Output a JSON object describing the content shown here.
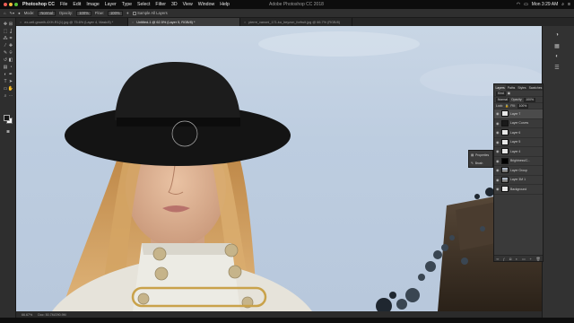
{
  "menubar": {
    "app_name": "Photoshop CC",
    "items": [
      "File",
      "Edit",
      "Image",
      "Layer",
      "Type",
      "Select",
      "Filter",
      "3D",
      "View",
      "Window",
      "Help"
    ],
    "window_title": "Adobe Photoshop CC 2018",
    "clock": "Mon 3:29 AM"
  },
  "options_bar": {
    "mode_label": "Mode:",
    "mode_value": "Normal",
    "opacity_label": "Opacity:",
    "opacity_value": "100%",
    "flow_label": "Flow:",
    "flow_value": "100%",
    "sample_label": "Sample All Layers"
  },
  "tabs": [
    {
      "label": "ex-cell-growth-4XH-R1(1).jpg @ 75.6% (Layer 4, Mask/8) *",
      "active": false
    },
    {
      "label": "Untitled-1 @ 62.5% (Layer 5, RGB/8) *",
      "active": true
    },
    {
      "label": "pierre_vanoni_171-ko_heyzon_forfruit.jpg @ 66.7% (RGB/8)",
      "active": false
    }
  ],
  "status": {
    "zoom": "66.67%",
    "doc_info": "Doc: 50.7M/290.9M"
  },
  "layers_panel": {
    "tabs": [
      "Layers",
      "Paths",
      "Styles",
      "Swatches"
    ],
    "kind_label": "Kind",
    "blend_mode": "Normal",
    "opacity_label": "Opacity:",
    "opacity_value": "100%",
    "lock_label": "Lock:",
    "fill_label": "Fill:",
    "fill_value": "100%",
    "layers": [
      {
        "name": "Layer 7",
        "thumb": "light",
        "selected": true
      },
      {
        "name": "Layer Curves",
        "thumb": "dark",
        "selected": false
      },
      {
        "name": "Layer 6",
        "thumb": "light",
        "selected": false
      },
      {
        "name": "Layer 5",
        "thumb": "light",
        "selected": false
      },
      {
        "name": "Layer 4",
        "thumb": "light",
        "selected": false
      },
      {
        "name": "Brightness/C...",
        "thumb": "mask",
        "selected": false
      },
      {
        "name": "Layer Group",
        "thumb": "photo",
        "selected": false
      },
      {
        "name": "Layer 3M 1",
        "thumb": "photo",
        "selected": false
      },
      {
        "name": "Background",
        "thumb": "light",
        "selected": false
      }
    ],
    "footer_icons": [
      "link-icon",
      "fx-icon",
      "mask-icon",
      "adjustment-icon",
      "folder-icon",
      "new-layer-icon",
      "trash-icon"
    ]
  },
  "properties_flyout": {
    "items": [
      "Properties",
      "Brush"
    ]
  },
  "colors": {
    "accent_selected_tab": "#3b3b3b",
    "foreground_color": "#151515",
    "background_color": "#f5f5f5"
  }
}
